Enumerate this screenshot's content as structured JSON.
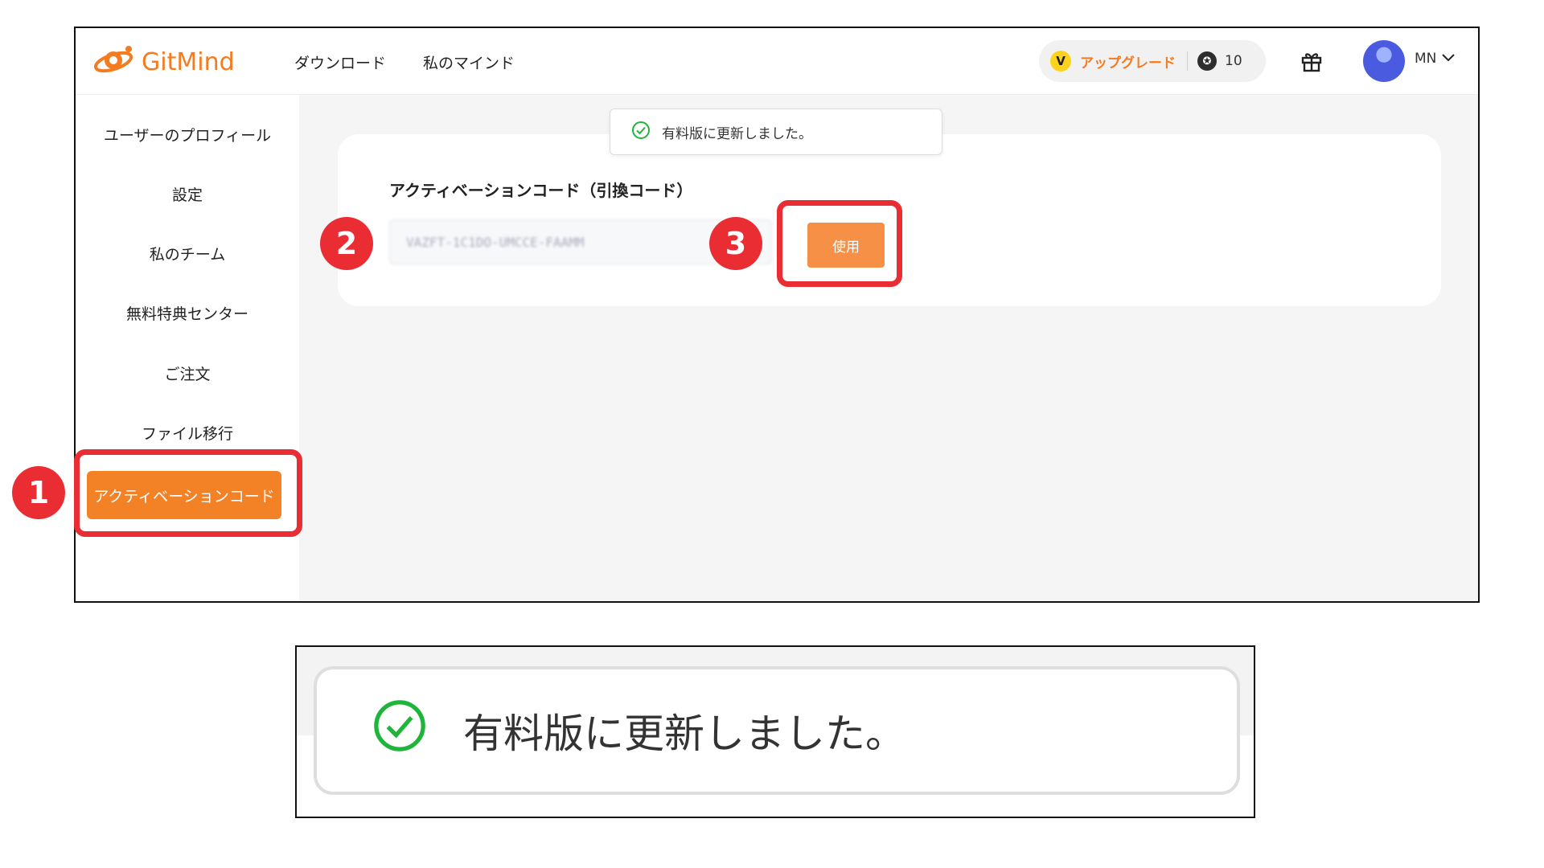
{
  "header": {
    "logo_text": "GitMind",
    "nav": [
      "ダウンロード",
      "私のマインド"
    ],
    "upgrade_label": "アップグレード",
    "coins": "10",
    "user_initials": "MN"
  },
  "sidebar": {
    "items": [
      "ユーザーのプロフィール",
      "設定",
      "私のチーム",
      "無料特典センター",
      "ご注文",
      "ファイル移行"
    ],
    "active_item": "アクティベーションコード"
  },
  "main": {
    "card_title": "アクティベーションコード（引換コード）",
    "code_value": "VAZFT-1C1DO-UMCCE-FAAMM",
    "use_button": "使用"
  },
  "toast": {
    "message": "有料版に更新しました。"
  },
  "annotations": {
    "step1": "1",
    "step2": "2",
    "step3": "3"
  },
  "colors": {
    "brand": "#f47b20",
    "active": "#f38226",
    "button": "#f79047",
    "highlight": "#ea2c33",
    "success": "#1eb53a"
  },
  "icons": [
    "gitmind-logo-icon",
    "v-badge-icon",
    "coin-icon",
    "gift-icon",
    "avatar",
    "chevron-down-icon",
    "check-circle-icon"
  ]
}
